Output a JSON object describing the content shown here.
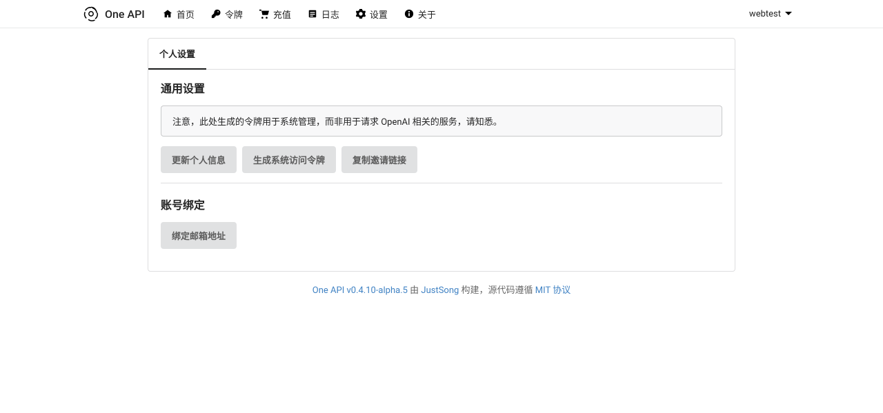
{
  "brand": {
    "name": "One API"
  },
  "nav": {
    "items": [
      {
        "label": "首页"
      },
      {
        "label": "令牌"
      },
      {
        "label": "充值"
      },
      {
        "label": "日志"
      },
      {
        "label": "设置"
      },
      {
        "label": "关于"
      }
    ]
  },
  "user": {
    "name": "webtest"
  },
  "tabs": {
    "active": "个人设置"
  },
  "sections": {
    "general": {
      "title": "通用设置",
      "notice": "注意，此处生成的令牌用于系统管理，而非用于请求 OpenAI 相关的服务，请知悉。",
      "buttons": {
        "update_profile": "更新个人信息",
        "gen_token": "生成系统访问令牌",
        "copy_invite": "复制邀请链接"
      }
    },
    "binding": {
      "title": "账号绑定",
      "buttons": {
        "bind_email": "绑定邮箱地址"
      }
    }
  },
  "footer": {
    "version_link": "One API v0.4.10-alpha.5",
    "by_text": " 由 ",
    "author_link": "JustSong",
    "built_text": " 构建，源代码遵循 ",
    "license_link": "MIT 协议"
  }
}
